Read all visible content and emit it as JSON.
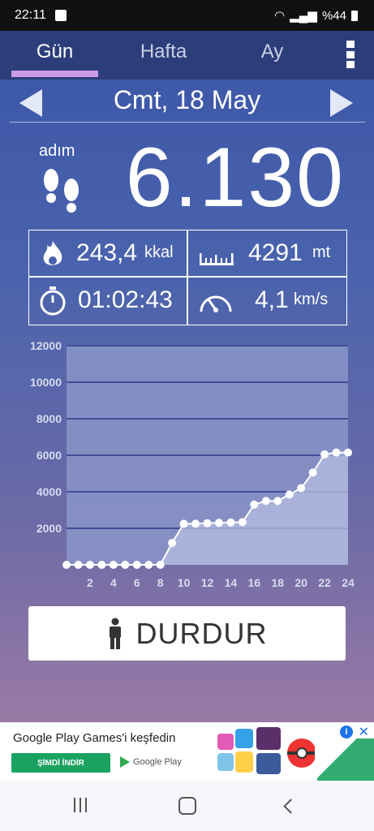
{
  "status": {
    "time": "22:11",
    "battery": "%44"
  },
  "tabs": [
    {
      "label": "Gün",
      "active": true
    },
    {
      "label": "Hafta",
      "active": false
    },
    {
      "label": "Ay",
      "active": false
    }
  ],
  "date": {
    "label": "Cmt, 18 May"
  },
  "steps": {
    "label": "adım",
    "value": "6.130"
  },
  "stats": {
    "calories": {
      "value": "243,4",
      "unit": "kkal"
    },
    "distance": {
      "value": "4291",
      "unit": "mt"
    },
    "duration": {
      "value": "01:02:43"
    },
    "speed": {
      "value": "4,1",
      "unit": "km/s"
    }
  },
  "chart_data": {
    "type": "area",
    "x": [
      0,
      1,
      2,
      3,
      4,
      5,
      6,
      7,
      8,
      9,
      10,
      11,
      12,
      13,
      14,
      15,
      16,
      17,
      18,
      19,
      20,
      21,
      22,
      23,
      24
    ],
    "values": [
      0,
      0,
      0,
      0,
      0,
      0,
      0,
      0,
      0,
      1200,
      2250,
      2250,
      2280,
      2300,
      2320,
      2340,
      3300,
      3500,
      3500,
      3850,
      4200,
      5050,
      6050,
      6150,
      6150
    ],
    "x_ticks": [
      "2",
      "4",
      "6",
      "8",
      "10",
      "12",
      "14",
      "16",
      "18",
      "20",
      "22",
      "24"
    ],
    "y_ticks": [
      "2000",
      "4000",
      "6000",
      "8000",
      "10000",
      "12000"
    ],
    "ylim": [
      0,
      12000
    ],
    "xlim": [
      0,
      24
    ],
    "grid": true
  },
  "stop_button": {
    "label": "DURDUR"
  },
  "ad": {
    "title": "Google Play Games'i keşfedin",
    "cta": "ŞİMDİ İNDİR",
    "store": "Google Play",
    "info_icon": "i",
    "close_icon": "✕"
  },
  "colors": {
    "tabbar": "#2c3e7a",
    "indicator": "#c99de8",
    "gridline": "#3e4f96",
    "plot_bg": "#8a95c8"
  }
}
